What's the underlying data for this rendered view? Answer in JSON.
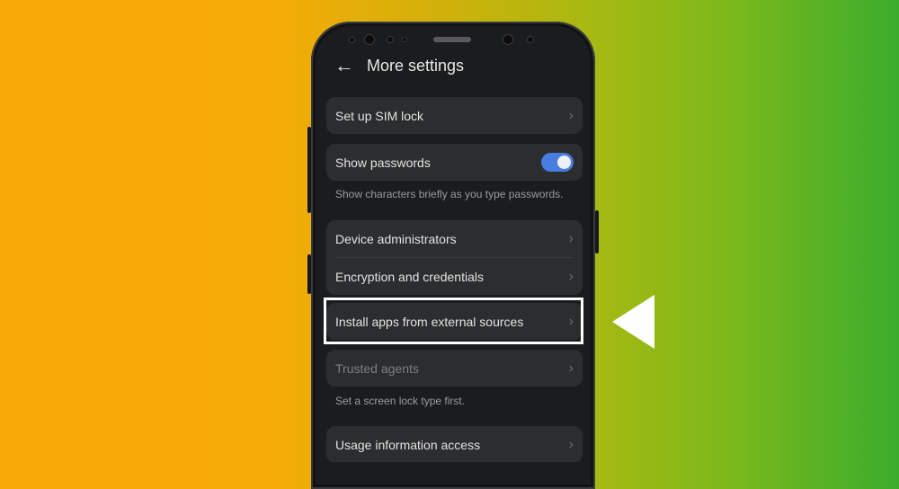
{
  "screen": {
    "header": {
      "back_icon": "arrow-left-icon",
      "title": "More settings"
    },
    "groups": [
      {
        "items": [
          {
            "label": "Set up SIM lock",
            "chevron": true
          }
        ]
      },
      {
        "items": [
          {
            "label": "Show passwords",
            "toggle": {
              "on": true,
              "color": "#4a7de0"
            }
          }
        ],
        "hint": "Show characters briefly as you type passwords."
      },
      {
        "items": [
          {
            "label": "Device administrators",
            "chevron": true
          },
          {
            "label": "Encryption and credentials",
            "chevron": true
          }
        ]
      },
      {
        "items": [
          {
            "label": "Install apps from external sources",
            "chevron": true,
            "highlighted": true
          }
        ]
      },
      {
        "items": [
          {
            "label": "Trusted agents",
            "chevron": true,
            "disabled": true
          }
        ],
        "hint": "Set a screen lock type first."
      },
      {
        "items": [
          {
            "label": "Usage information access",
            "chevron": true
          }
        ]
      }
    ]
  },
  "annotation": {
    "highlight_color": "#ffffff",
    "pointer_icon": "triangle-left-icon"
  },
  "glyphs": {
    "chevron": "›",
    "back": "←"
  },
  "background": {
    "gradient_start": "#f9a908",
    "gradient_end": "#3bac2c"
  }
}
